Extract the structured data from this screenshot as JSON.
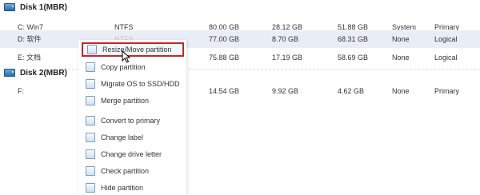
{
  "disks": [
    {
      "title": "Disk 1(MBR)",
      "partitions": [
        {
          "name": "C: Win7",
          "fs": "NTFS",
          "capacity": "80.00 GB",
          "used": "28.12 GB",
          "unused": "51.88 GB",
          "status": "System",
          "type": "Primary"
        },
        {
          "name": "D: 软件",
          "fs": "NTFS",
          "capacity": "77.00 GB",
          "used": "8.70 GB",
          "unused": "68.31 GB",
          "status": "None",
          "type": "Logical"
        },
        {
          "name": "E: 文档",
          "fs": "",
          "capacity": "75.88 GB",
          "used": "17.19 GB",
          "unused": "58.69 GB",
          "status": "None",
          "type": "Logical"
        }
      ]
    },
    {
      "title": "Disk 2(MBR)",
      "partitions": [
        {
          "name": "F:",
          "fs": "",
          "capacity": "14.54 GB",
          "used": "9.92 GB",
          "unused": "4.62 GB",
          "status": "None",
          "type": "Primary"
        }
      ]
    }
  ],
  "context_menu": {
    "items": [
      {
        "label": "Resize/Move partition",
        "icon": "resize-icon",
        "highlighted": true
      },
      {
        "label": "Copy partition",
        "icon": "copy-icon"
      },
      {
        "label": "Migrate OS to SSD/HDD",
        "icon": "migrate-icon"
      },
      {
        "label": "Merge partition",
        "icon": "merge-icon"
      },
      {
        "label": "Convert to primary",
        "icon": "convert-icon"
      },
      {
        "label": "Change label",
        "icon": "label-icon"
      },
      {
        "label": "Change drive letter",
        "icon": "drive-letter-icon"
      },
      {
        "label": "Check partition",
        "icon": "check-icon"
      },
      {
        "label": "Hide partition",
        "icon": "hide-icon"
      }
    ]
  },
  "colors": {
    "highlight_border": "#c0262c",
    "selected_row": "#e9eef6"
  }
}
